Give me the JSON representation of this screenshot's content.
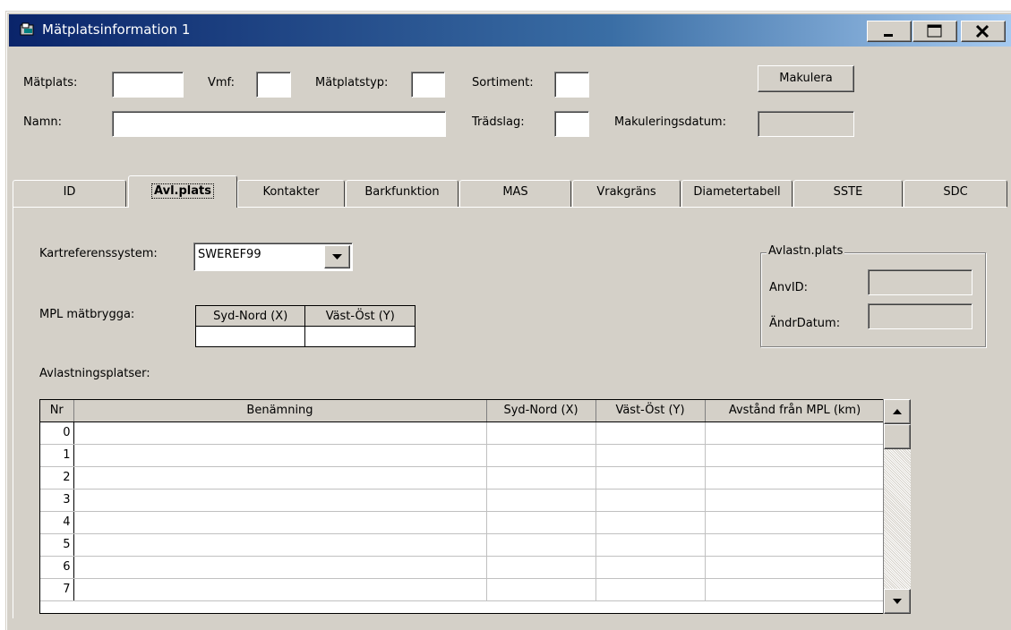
{
  "window": {
    "title": "Mätplatsinformation 1",
    "minimize_label": "_",
    "maximize_label": "□",
    "close_label": "✕"
  },
  "header": {
    "matplats_label": "Mätplats:",
    "matplats_value": "",
    "vmf_label": "Vmf:",
    "vmf_value": "",
    "matplatstyp_label": "Mätplatstyp:",
    "matplatstyp_value": "",
    "sortiment_label": "Sortiment:",
    "sortiment_value": "",
    "makulera_label": "Makulera",
    "namn_label": "Namn:",
    "namn_value": "",
    "tradslag_label": "Trädslag:",
    "tradslag_value": "",
    "makuleringsdatum_label": "Makuleringsdatum:",
    "makuleringsdatum_value": ""
  },
  "tabs": [
    {
      "label": "ID"
    },
    {
      "label": "Avl.plats"
    },
    {
      "label": "Kontakter"
    },
    {
      "label": "Barkfunktion"
    },
    {
      "label": "MAS"
    },
    {
      "label": "Vrakgräns"
    },
    {
      "label": "Diametertabell"
    },
    {
      "label": "SSTE"
    },
    {
      "label": "SDC"
    }
  ],
  "panel": {
    "kartref_label": "Kartreferenssystem:",
    "kartref_value": "SWEREF99",
    "mpl_label": "MPL mätbrygga:",
    "mpl_headers": [
      "Syd-Nord (X)",
      "Väst-Öst (Y)"
    ],
    "mpl_values": [
      "",
      ""
    ],
    "avlastn_group_title": "Avlastn.plats",
    "anvid_label": "AnvID:",
    "anvid_value": "",
    "andrdatum_label": "ÄndrDatum:",
    "andrdatum_value": "",
    "avlastningsplatser_label": "Avlastningsplatser:"
  },
  "grid": {
    "headers": [
      "Nr",
      "Benämning",
      "Syd-Nord (X)",
      "Väst-Öst (Y)",
      "Avstånd från MPL (km)"
    ],
    "rows": [
      {
        "nr": "0",
        "benamning": "",
        "x": "",
        "y": "",
        "avstand": ""
      },
      {
        "nr": "1",
        "benamning": "",
        "x": "",
        "y": "",
        "avstand": ""
      },
      {
        "nr": "2",
        "benamning": "",
        "x": "",
        "y": "",
        "avstand": ""
      },
      {
        "nr": "3",
        "benamning": "",
        "x": "",
        "y": "",
        "avstand": ""
      },
      {
        "nr": "4",
        "benamning": "",
        "x": "",
        "y": "",
        "avstand": ""
      },
      {
        "nr": "5",
        "benamning": "",
        "x": "",
        "y": "",
        "avstand": ""
      },
      {
        "nr": "6",
        "benamning": "",
        "x": "",
        "y": "",
        "avstand": ""
      },
      {
        "nr": "7",
        "benamning": "",
        "x": "",
        "y": "",
        "avstand": ""
      }
    ]
  },
  "colors": {
    "titlebar_start": "#0a246a",
    "titlebar_end": "#a6caf0",
    "face": "#d4d0c8"
  }
}
